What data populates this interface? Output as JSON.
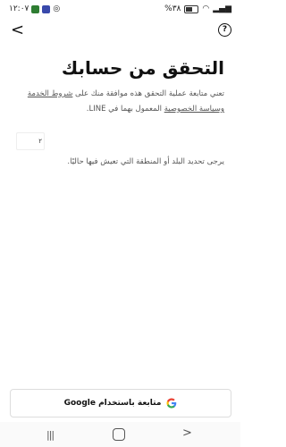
{
  "status": {
    "time": "١٢:٠٧",
    "battery": "%٣٨"
  },
  "topbar": {
    "back_glyph": "<",
    "help_glyph": "?"
  },
  "main": {
    "title": "التحقق من حسابك",
    "desc_prefix": "تعني متابعة عملية التحقق هذه موافقة منك على ",
    "terms_link": "شروط الخدمة",
    "desc_middle": " ",
    "privacy_link": "وسياسة الخصوصية",
    "desc_suffix": " المعمول بهما في LINE.",
    "region_value": "٢",
    "hint": "يرجى تحديد البلد أو المنطقة التي تعيش فيها حاليًا."
  },
  "google_button": {
    "label": "متابعة باستخدام Google"
  },
  "colors": {
    "google_blue": "#4285F4",
    "google_red": "#EA4335",
    "google_yellow": "#FBBC05",
    "google_green": "#34A853"
  }
}
